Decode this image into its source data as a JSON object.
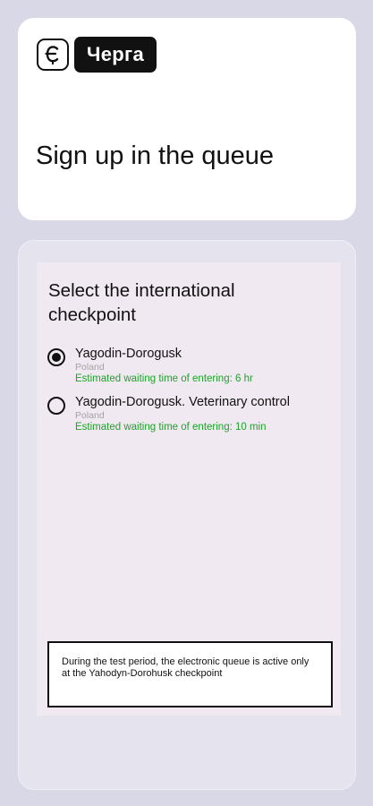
{
  "header": {
    "logo_badge": "Черга",
    "title": "Sign up in the queue"
  },
  "checkpoint_section": {
    "title": "Select the international checkpoint",
    "options": [
      {
        "name": "Yagodin-Dorogusk",
        "country": "Poland",
        "wait": "Estimated waiting time of entering: 6 hr",
        "selected": true
      },
      {
        "name": "Yagodin-Dorogusk. Veterinary control",
        "country": "Poland",
        "wait": "Estimated waiting time of entering: 10 min",
        "selected": false
      }
    ],
    "notice": "During the test period, the electronic queue is active only at the Yahodyn-Dorohusk checkpoint"
  },
  "colors": {
    "background": "#d9d8e6",
    "card": "#ffffff",
    "panel": "#f1e9f1",
    "accent_green": "#1fa32a",
    "text": "#111111"
  },
  "icons": {
    "logo": "hryvnia-e-icon"
  }
}
